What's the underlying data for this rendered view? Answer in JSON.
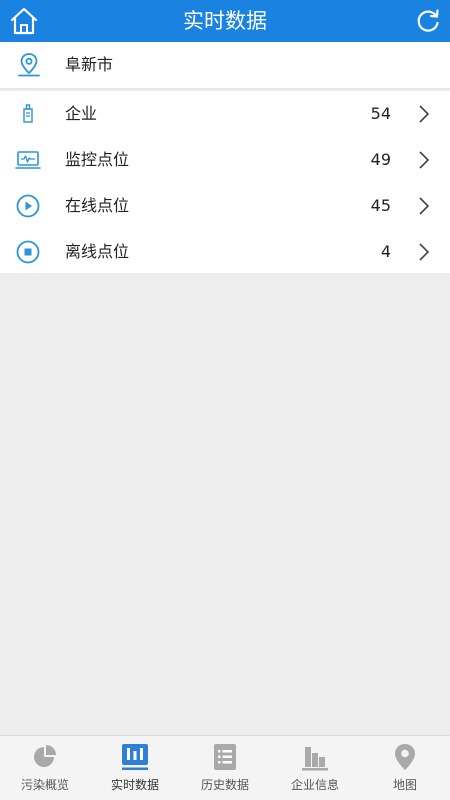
{
  "header": {
    "title": "实时数据"
  },
  "location": {
    "label": "阜新市"
  },
  "list": [
    {
      "label": "企业",
      "count": "54"
    },
    {
      "label": "监控点位",
      "count": "49"
    },
    {
      "label": "在线点位",
      "count": "45"
    },
    {
      "label": "离线点位",
      "count": "4"
    }
  ],
  "tabs": [
    {
      "label": "污染概览",
      "icon": "pie-chart-icon",
      "active": false
    },
    {
      "label": "实时数据",
      "icon": "bar-chart-icon",
      "active": true
    },
    {
      "label": "历史数据",
      "icon": "list-document-icon",
      "active": false
    },
    {
      "label": "企业信息",
      "icon": "building-icon",
      "active": false
    },
    {
      "label": "地图",
      "icon": "map-pin-icon",
      "active": false
    }
  ],
  "colors": {
    "primary": "#1a82e0",
    "icon_accent": "#2a95d8",
    "tab_active": "#2f7fd6",
    "tab_inactive": "#a9a9a9"
  }
}
